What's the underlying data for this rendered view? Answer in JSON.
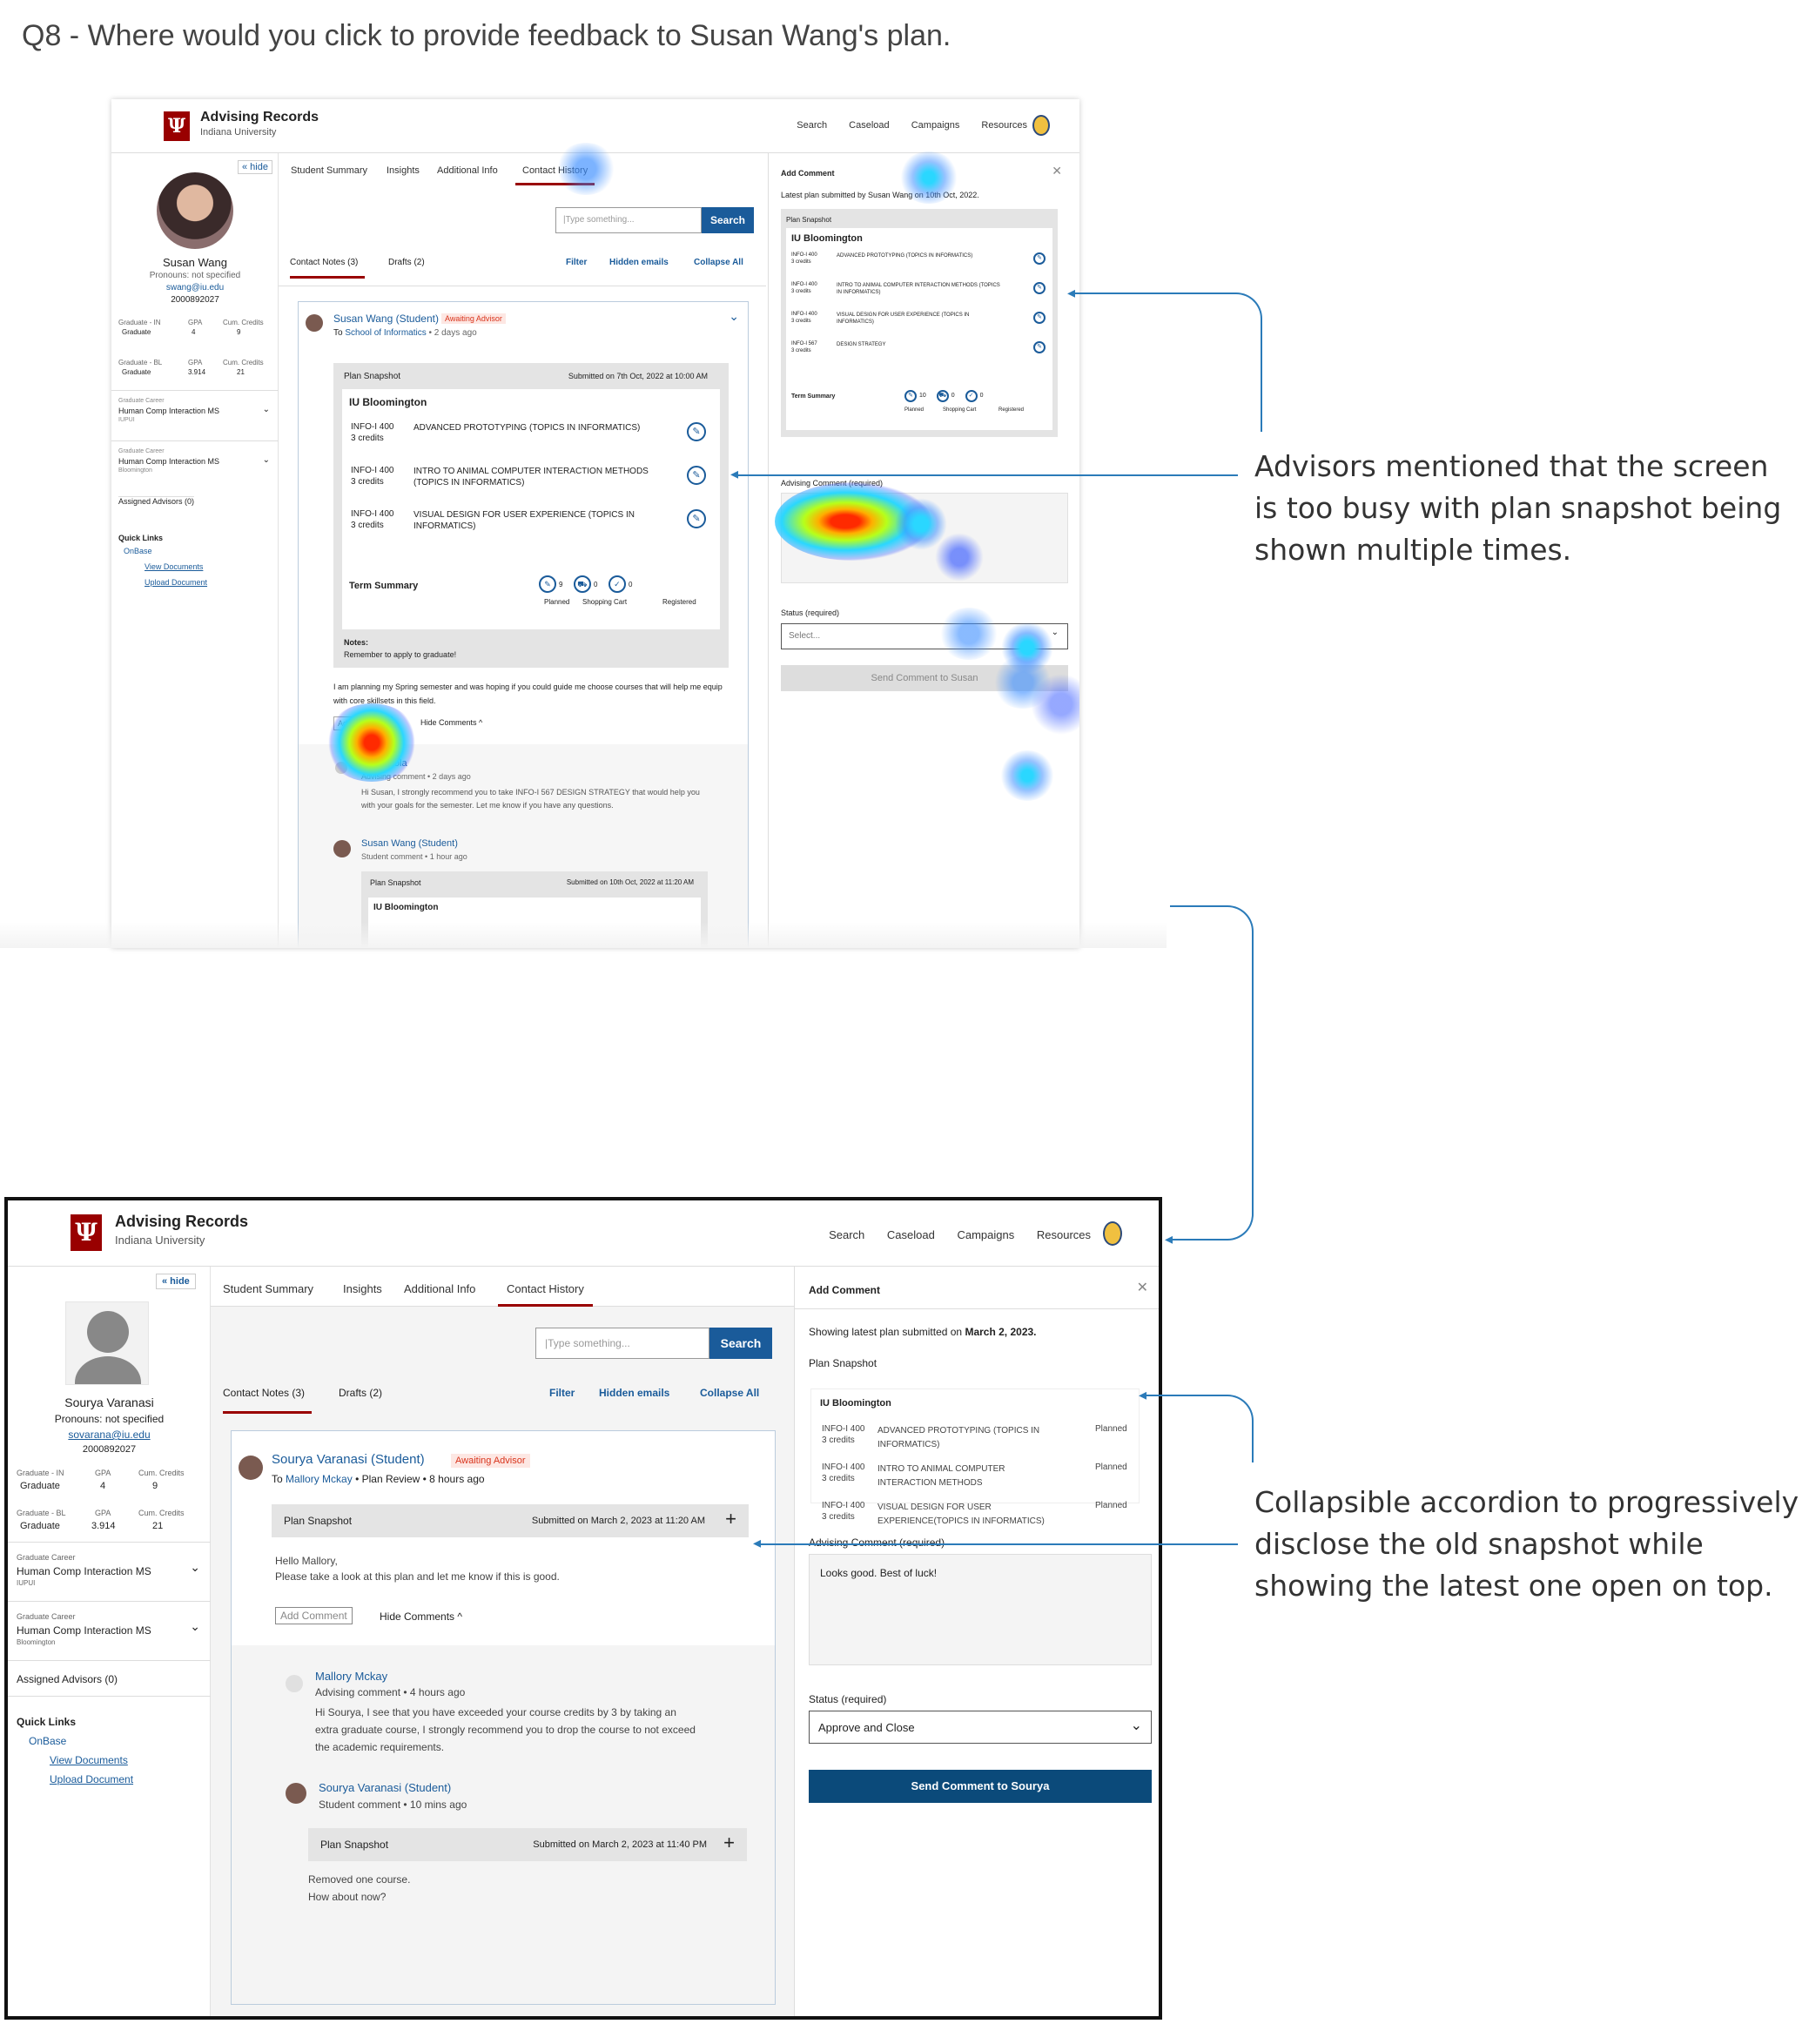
{
  "question": "Q8 - Where would you click to provide feedback to Susan Wang's plan.",
  "top": {
    "app_title": "Advising Records",
    "app_sub": "Indiana University",
    "nav": [
      "Search",
      "Caseload",
      "Campaigns",
      "Resources"
    ],
    "hide": "« hide",
    "student": {
      "name": "Susan Wang",
      "pronouns": "Pronouns: not specified",
      "email": "swang@iu.edu",
      "id": "2000892027"
    },
    "stats1": {
      "l1": "Graduate - IN",
      "v1": "Graduate",
      "l2": "GPA",
      "v2": "4",
      "l3": "Cum. Credits",
      "v3": "9"
    },
    "stats2": {
      "l1": "Graduate - BL",
      "v1": "Graduate",
      "l2": "GPA",
      "v2": "3.914",
      "l3": "Cum. Credits",
      "v3": "21"
    },
    "career1": {
      "label": "Graduate Career",
      "value": "Human Comp Interaction MS",
      "sub": "IUPUI"
    },
    "career2": {
      "label": "Graduate Career",
      "value": "Human Comp Interaction MS",
      "sub": "Bloomington"
    },
    "advisors": "Assigned Advisors (0)",
    "quick": "Quick Links",
    "onbase": "OnBase",
    "view_docs": "View Documents",
    "upload_doc": "Upload Document",
    "tabs": [
      "Student Summary",
      "Insights",
      "Additional Info",
      "Contact History"
    ],
    "search_ph": "|Type something...",
    "search_btn": "Search",
    "subtabs": [
      "Contact Notes (3)",
      "Drafts (2)"
    ],
    "actions": [
      "Filter",
      "Hidden emails",
      "Collapse All"
    ],
    "note_from": "Susan Wang (Student)",
    "badge": "Awaiting Advisor",
    "to": "To",
    "to_who": "School of Informatics",
    "ago": "• 2 days ago",
    "snap_title": "Plan Snapshot",
    "snap_sub": "Submitted on 7th Oct, 2022 at 10:00 AM",
    "campus": "IU Bloomington",
    "courses": [
      {
        "code": "INFO-I 400",
        "cr": "3 credits",
        "name": "ADVANCED PROTOTYPING (TOPICS IN INFORMATICS)"
      },
      {
        "code": "INFO-I 400",
        "cr": "3 credits",
        "name": "INTRO TO ANIMAL COMPUTER INTERACTION METHODS (TOPICS IN INFORMATICS)"
      },
      {
        "code": "INFO-I 400",
        "cr": "3 credits",
        "name": "VISUAL DESIGN FOR USER EXPERIENCE (TOPICS IN INFORMATICS)"
      }
    ],
    "term_summary": "Term Summary",
    "term_labels": [
      "Planned",
      "Shopping Cart",
      "Registered"
    ],
    "term_counts": [
      "9",
      "0",
      "0"
    ],
    "notes_label": "Notes:",
    "notes_text": "Remember to apply to graduate!",
    "message": "I am planning my Spring semester and was hoping if you could guide me choose courses that will help me equip with core skillsets in this field.",
    "add_comment_btn": "Add Comment",
    "hide_comments": "Hide Comments ^",
    "c1_name": "Kris Nicola",
    "c1_meta": "Advising comment • 2 days ago",
    "c1_text": "Hi Susan, I strongly recommend you to take INFO-I 567 DESIGN STRATEGY that would help you with your goals for the semester. Let me know if you have any questions.",
    "c2_name": "Susan Wang (Student)",
    "c2_meta": "Student comment • 1 hour ago",
    "snap2_title": "Plan Snapshot",
    "snap2_sub": "Submitted on 10th Oct, 2022 at 11:20 AM",
    "snap2_campus": "IU Bloomington",
    "panel_title": "Add Comment",
    "latest": "Latest plan submitted by Susan Wang on 10th Oct, 2022.",
    "p_snap": "Plan Snapshot",
    "p_campus": "IU Bloomington",
    "p_courses": [
      {
        "code": "INFO-I 400",
        "cr": "3 credits",
        "name": "ADVANCED PROTOTYPING (TOPICS IN INFORMATICS)"
      },
      {
        "code": "INFO-I 400",
        "cr": "3 credits",
        "name": "INTRO TO ANIMAL COMPUTER INTERACTION METHODS (TOPICS IN INFORMATICS)"
      },
      {
        "code": "INFO-I 400",
        "cr": "3 credits",
        "name": "VISUAL DESIGN FOR USER EXPERIENCE (TOPICS IN INFORMATICS)"
      },
      {
        "code": "INFO-I 567",
        "cr": "3 credits",
        "name": "DESIGN STRATEGY"
      }
    ],
    "p_term": "Term Summary",
    "p_term_counts": [
      "10",
      "0",
      "0"
    ],
    "p_term_labels": [
      "Planned",
      "Shopping Cart",
      "Registered"
    ],
    "adv_comment": "Advising Comment (required)",
    "status": "Status (required)",
    "select_ph": "Select...",
    "send": "Send Comment to Susan"
  },
  "note1": "Advisors mentioned that the screen is too busy with plan snapshot being shown multiple times.",
  "bottom": {
    "app_title": "Advising Records",
    "app_sub": "Indiana University",
    "nav": [
      "Search",
      "Caseload",
      "Campaigns",
      "Resources"
    ],
    "hide": "« hide",
    "student": {
      "name": "Sourya Varanasi",
      "pronouns": "Pronouns: not specified",
      "email": "sovarana@iu.edu",
      "id": "2000892027"
    },
    "stats1": {
      "l1": "Graduate - IN",
      "v1": "Graduate",
      "l2": "GPA",
      "v2": "4",
      "l3": "Cum. Credits",
      "v3": "9"
    },
    "stats2": {
      "l1": "Graduate - BL",
      "v1": "Graduate",
      "l2": "GPA",
      "v2": "3.914",
      "l3": "Cum. Credits",
      "v3": "21"
    },
    "career1": {
      "label": "Graduate Career",
      "value": "Human Comp Interaction MS",
      "sub": "IUPUI"
    },
    "career2": {
      "label": "Graduate Career",
      "value": "Human Comp Interaction MS",
      "sub": "Bloomington"
    },
    "advisors": "Assigned Advisors (0)",
    "quick": "Quick Links",
    "onbase": "OnBase",
    "view_docs": "View Documents",
    "upload_doc": "Upload Document",
    "tabs": [
      "Student Summary",
      "Insights",
      "Additional Info",
      "Contact History"
    ],
    "search_ph": "|Type something...",
    "search_btn": "Search",
    "subtabs": [
      "Contact Notes (3)",
      "Drafts (2)"
    ],
    "actions": [
      "Filter",
      "Hidden emails",
      "Collapse All"
    ],
    "note_from": "Sourya Varanasi (Student)",
    "badge": "Awaiting Advisor",
    "to": "To",
    "to_who": "Mallory Mckay",
    "meta": "• Plan Review • 8 hours ago",
    "snap_title": "Plan Snapshot",
    "snap_sub": "Submitted on March 2, 2023 at 11:20 AM",
    "msg1": "Hello Mallory,",
    "msg2": "Please take a look at this plan and let me know if this is good.",
    "add_comment_btn": "Add Comment",
    "hide_comments": "Hide Comments ^",
    "c1_name": "Mallory Mckay",
    "c1_meta": "Advising comment • 4 hours ago",
    "c1_text": "Hi Sourya, I see that you have exceeded your course credits by 3 by taking an extra graduate course, I strongly recommend you to drop the course to not exceed the academic requirements.",
    "c2_name": "Sourya Varanasi (Student)",
    "c2_meta": "Student comment • 10 mins ago",
    "snap2_title": "Plan Snapshot",
    "snap2_sub": "Submitted on March 2, 2023 at 11:40 PM",
    "reply1": "Removed one course.",
    "reply2": "How about now?",
    "panel_title": "Add Comment",
    "latest_pre": "Showing latest plan submitted on ",
    "latest_date": "March 2, 2023.",
    "p_snap": "Plan Snapshot",
    "p_campus": "IU Bloomington",
    "p_courses": [
      {
        "code": "INFO-I 400",
        "cr": "3 credits",
        "name": "ADVANCED PROTOTYPING (TOPICS IN INFORMATICS)",
        "st": "Planned"
      },
      {
        "code": "INFO-I 400",
        "cr": "3 credits",
        "name": "INTRO TO ANIMAL COMPUTER INTERACTION METHODS",
        "st": "Planned"
      },
      {
        "code": "INFO-I 400",
        "cr": "3 credits",
        "name": "VISUAL DESIGN FOR USER EXPERIENCE(TOPICS IN INFORMATICS)",
        "st": "Planned"
      }
    ],
    "adv_comment": "Advising Comment (required)",
    "comment_text": "Looks good. Best of luck!",
    "status": "Status (required)",
    "status_val": "Approve and Close",
    "send": "Send Comment to Sourya"
  },
  "note2": "Collapsible accordion to progressively disclose the old snapshot while showing the latest one open on top.",
  "colors": {
    "iu_red": "#990000",
    "link_blue": "#1a5b9a",
    "send_blue": "#0b4a7a",
    "arrow": "#2b7bb9",
    "badge_red": "#d9341c"
  }
}
